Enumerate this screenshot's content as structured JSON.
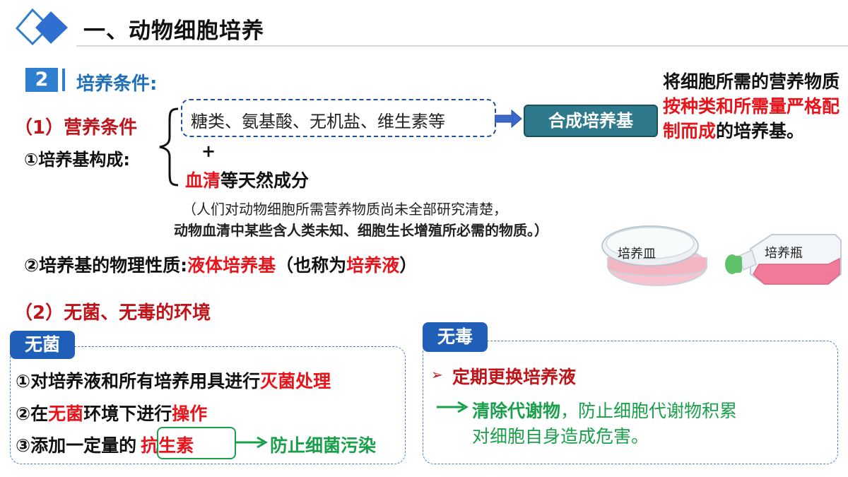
{
  "header": {
    "title": "一、动物细胞培养"
  },
  "section": {
    "number": "2",
    "title": "培养条件:"
  },
  "nutrition": {
    "heading": "（1）营养条件",
    "medium_label": "①培养基构成:",
    "components": "糖类、氨基酸、无机盐、维生素等",
    "plus": "+",
    "serum_red": "血清",
    "serum_rest": "等天然成分",
    "synthetic_label": "合成培养基",
    "definition": {
      "part1": "将细胞所需的营养物质",
      "part2_red": "按种类和所需量严格配制而成",
      "part3": "的培养基。"
    },
    "note_line1": "（人们对动物细胞所需营养物质尚未全部研究清楚，",
    "note_line2": "动物血清中某些含人类未知、细胞生长增殖所必需的物质。）",
    "physical": {
      "prefix": "②培养基的物理性质:",
      "red1": "液体培养基",
      "mid": "（也称为",
      "red2": "培养液",
      "end": "）"
    }
  },
  "images": {
    "dish_label": "培养皿",
    "flask_label": "培养瓶"
  },
  "environment": {
    "heading": "（2）无菌、无毒的环境",
    "sterile": {
      "tab": "无菌",
      "item1_prefix": "①对培养液和所有培养用具进行",
      "item1_red": "灭菌处理",
      "item2_a": "②在",
      "item2_red1": "无菌",
      "item2_b": "环境下进行",
      "item2_red2": "操作",
      "item3_prefix": "③添加一定量的",
      "item3_red": "抗生素",
      "item3_green": "防止细菌污染"
    },
    "nontoxic": {
      "tab": "无毒",
      "item1": "定期更换培养液",
      "item2_bold": "清除代谢物",
      "item2_rest": "，防止细胞代谢物积累",
      "item3": "对细胞自身造成危害。"
    }
  }
}
